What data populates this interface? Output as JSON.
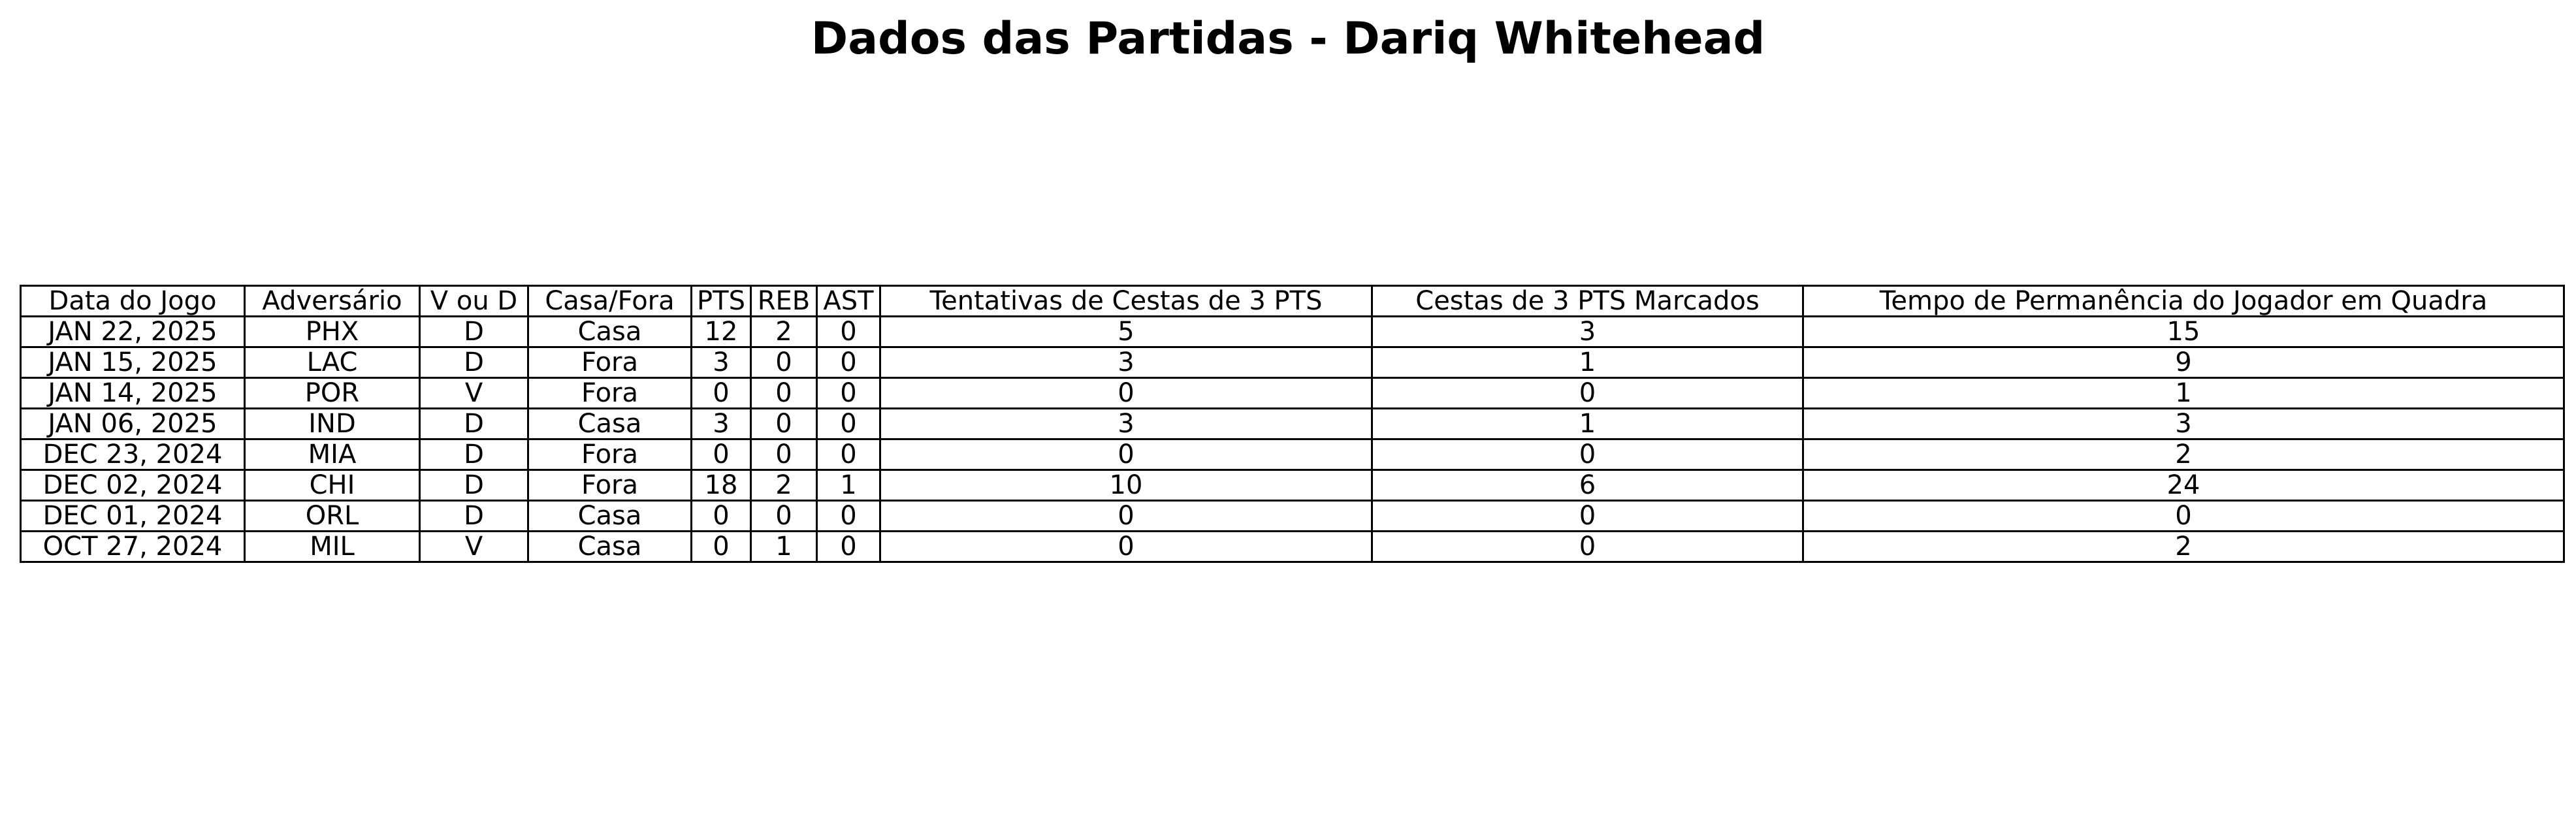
{
  "chart_data": {
    "type": "table",
    "title": "Dados das Partidas - Dariq Whitehead",
    "columns": [
      "Data do Jogo",
      "Adversário",
      "V ou D",
      "Casa/Fora",
      "PTS",
      "REB",
      "AST",
      "Tentativas de Cestas de 3 PTS",
      "Cestas de 3 PTS Marcados",
      "Tempo de Permanência do Jogador em Quadra"
    ],
    "rows": [
      [
        "JAN 22, 2025",
        "PHX",
        "D",
        "Casa",
        "12",
        "2",
        "0",
        "5",
        "3",
        "15"
      ],
      [
        "JAN 15, 2025",
        "LAC",
        "D",
        "Fora",
        "3",
        "0",
        "0",
        "3",
        "1",
        "9"
      ],
      [
        "JAN 14, 2025",
        "POR",
        "V",
        "Fora",
        "0",
        "0",
        "0",
        "0",
        "0",
        "1"
      ],
      [
        "JAN 06, 2025",
        "IND",
        "D",
        "Casa",
        "3",
        "0",
        "0",
        "3",
        "1",
        "3"
      ],
      [
        "DEC 23, 2024",
        "MIA",
        "D",
        "Fora",
        "0",
        "0",
        "0",
        "0",
        "0",
        "2"
      ],
      [
        "DEC 02, 2024",
        "CHI",
        "D",
        "Fora",
        "18",
        "2",
        "1",
        "10",
        "6",
        "24"
      ],
      [
        "DEC 01, 2024",
        "ORL",
        "D",
        "Casa",
        "0",
        "0",
        "0",
        "0",
        "0",
        "0"
      ],
      [
        "OCT 27, 2024",
        "MIL",
        "V",
        "Casa",
        "0",
        "1",
        "0",
        "0",
        "0",
        "2"
      ]
    ]
  }
}
